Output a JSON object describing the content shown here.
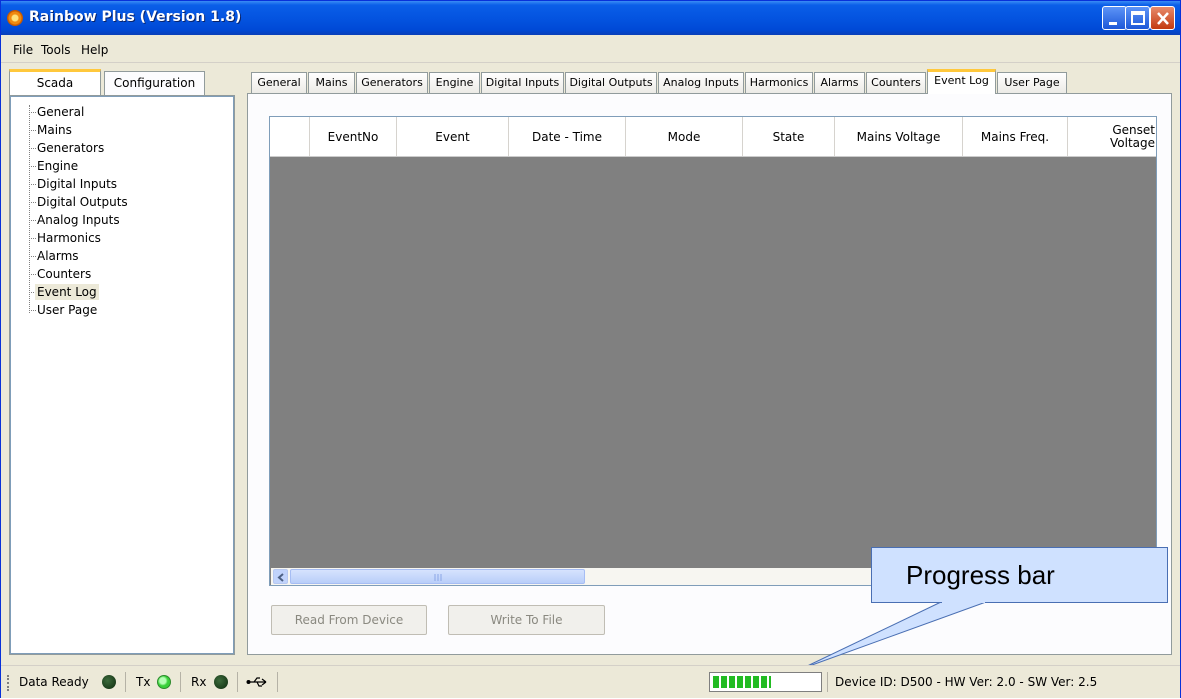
{
  "window": {
    "title": "Rainbow Plus (Version 1.8)",
    "app_icon": "rainbow-app-icon",
    "controls": [
      "minimize",
      "maximize",
      "close"
    ]
  },
  "menu": {
    "items": [
      {
        "label": "File"
      },
      {
        "label": "Tools"
      },
      {
        "label": "Help"
      }
    ]
  },
  "left_tabs": [
    {
      "label": "Scada",
      "active": true
    },
    {
      "label": "Configuration",
      "active": false
    }
  ],
  "tree": {
    "items": [
      {
        "label": "General"
      },
      {
        "label": "Mains"
      },
      {
        "label": "Generators"
      },
      {
        "label": "Engine"
      },
      {
        "label": "Digital Inputs"
      },
      {
        "label": "Digital Outputs"
      },
      {
        "label": "Analog Inputs"
      },
      {
        "label": "Harmonics"
      },
      {
        "label": "Alarms"
      },
      {
        "label": "Counters"
      },
      {
        "label": "Event Log",
        "selected": true
      },
      {
        "label": "User Page"
      }
    ]
  },
  "tabs": [
    {
      "label": "General"
    },
    {
      "label": "Mains"
    },
    {
      "label": "Generators"
    },
    {
      "label": "Engine"
    },
    {
      "label": "Digital Inputs"
    },
    {
      "label": "Digital Outputs"
    },
    {
      "label": "Analog Inputs"
    },
    {
      "label": "Harmonics"
    },
    {
      "label": "Alarms"
    },
    {
      "label": "Counters"
    },
    {
      "label": "Event Log",
      "active": true
    },
    {
      "label": "User Page"
    }
  ],
  "table": {
    "columns": [
      "",
      "Event No",
      "Event",
      "Date - Time",
      "Mode",
      "State",
      "Mains Voltage",
      "Mains Freq.",
      "Genset Voltage"
    ],
    "column_lines": [
      [
        "",
        ""
      ],
      [
        "Event",
        "No"
      ],
      [
        "Event",
        ""
      ],
      [
        "Date - Time",
        ""
      ],
      [
        "Mode",
        ""
      ],
      [
        "State",
        ""
      ],
      [
        "Mains Voltage",
        ""
      ],
      [
        "Mains Freq.",
        ""
      ],
      [
        "Genset",
        "Voltage"
      ]
    ],
    "rows": []
  },
  "buttons": {
    "read": "Read From Device",
    "write": "Write To File"
  },
  "callout": {
    "text": "Progress bar"
  },
  "status": {
    "data_ready": "Data Ready",
    "tx": "Tx",
    "rx": "Rx",
    "usb_icon": "usb-icon",
    "progress_fraction": 0.55,
    "device_info": "Device ID: D500 - HW Ver: 2.0 - SW Ver: 2.5"
  },
  "colors": {
    "title_bar": "#0454e0",
    "table_background": "#808080",
    "active_tab_accent": "#ffc83c",
    "progress_green": "#22bb22",
    "callout_fill": "#cfe1ff"
  }
}
